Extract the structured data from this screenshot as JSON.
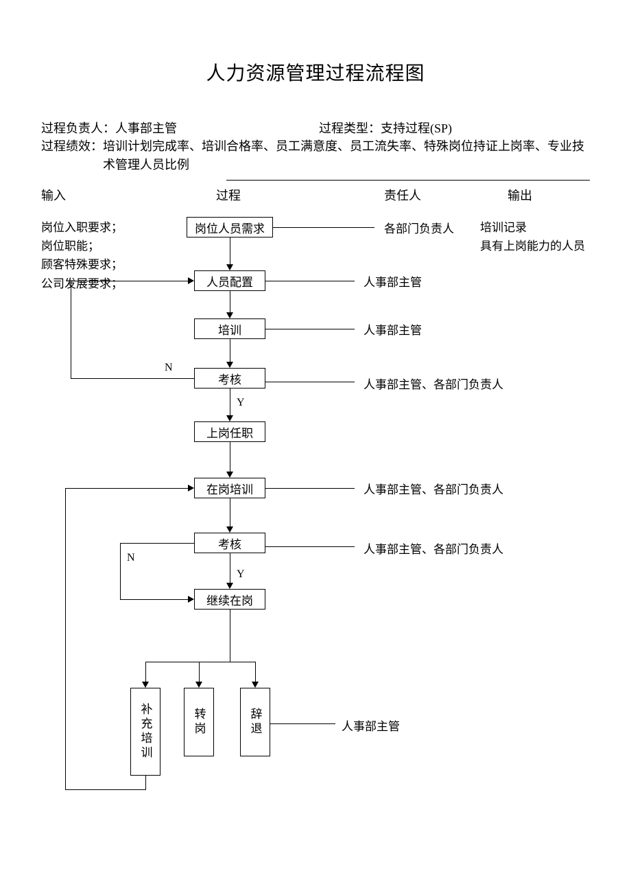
{
  "title": "人力资源管理过程流程图",
  "meta": {
    "owner_label": "过程负责人：人事部主管",
    "type_label": "过程类型：支持过程(SP)",
    "perf_label_prefix": "过程绩效：",
    "perf_line1": "培训计划完成率、培训合格率、员工满意度、员工流失率、特殊岗位持证上岗率、专业技",
    "perf_line2": "术管理人员比例"
  },
  "columns": {
    "input": "输入",
    "process": "过程",
    "owner": "责任人",
    "output": "输出"
  },
  "inputs": {
    "l1": "岗位入职要求；",
    "l2": "岗位职能；",
    "l3": "顾客特殊要求；",
    "l4": "公司发展要求；"
  },
  "outputs": {
    "l1": "培训记录",
    "l2": "具有上岗能力的人员"
  },
  "nodes": {
    "n1": "岗位人员需求",
    "n2": "人员配置",
    "n3": "培训",
    "n4": "考核",
    "n5": "上岗任职",
    "n6": "在岗培训",
    "n7": "考核",
    "n8": "继续在岗",
    "n9": "补充培训",
    "n10": "转岗",
    "n11": "辞退"
  },
  "resp": {
    "r1": "各部门负责人",
    "r2": "人事部主管",
    "r3": "人事部主管",
    "r4": "人事部主管、各部门负责人",
    "r6": "人事部主管、各部门负责人",
    "r7": "人事部主管、各部门负责人",
    "r11": "人事部主管"
  },
  "labels": {
    "N": "N",
    "Y": "Y"
  }
}
